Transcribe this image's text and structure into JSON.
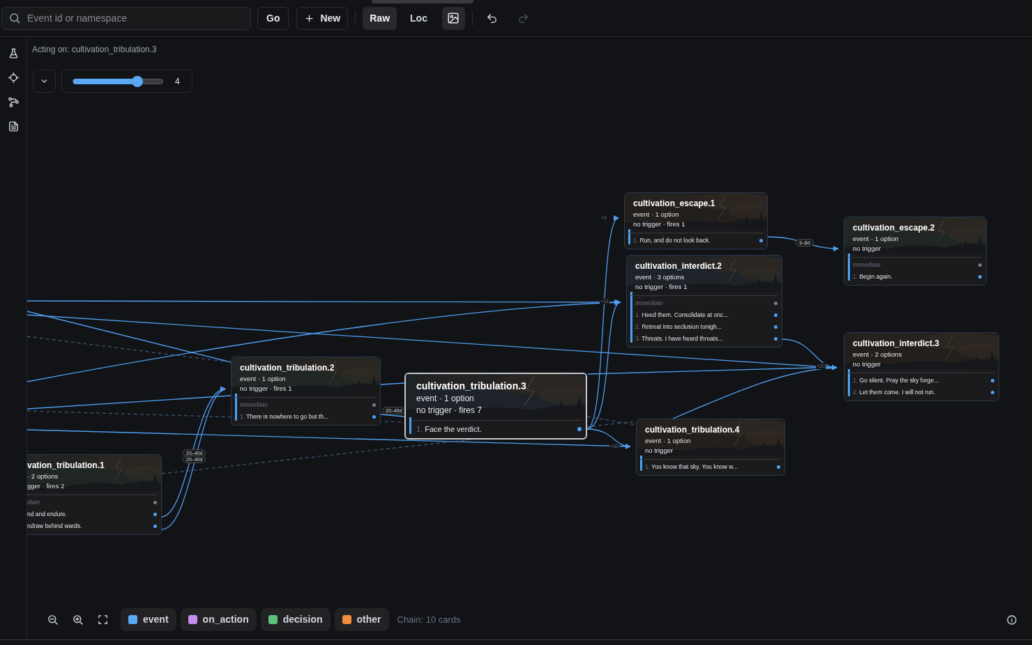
{
  "toolbar": {
    "search": {
      "placeholder": "Event id or namespace"
    },
    "go": "Go",
    "new": "New",
    "modes": [
      {
        "label": "Raw",
        "selected": true
      },
      {
        "label": "Loc",
        "selected": false
      }
    ],
    "image_toggle": {
      "on": true
    },
    "undo": {
      "disabled": false
    },
    "redo": {
      "disabled": true
    }
  },
  "sidebar": {
    "items": [
      {
        "kind": "flask"
      },
      {
        "kind": "target"
      },
      {
        "kind": "graph"
      },
      {
        "kind": "document"
      }
    ]
  },
  "acting_on": "Acting on: cultivation_tribulation.3",
  "depth": {
    "level": 0.72,
    "reading": "4"
  },
  "cards": [
    {
      "title": "cultivation_escape.1",
      "meta": [
        "event · 1 option",
        "no trigger · fires 1"
      ],
      "selected": false,
      "rows": [
        {
          "kind": "option",
          "n": "1.",
          "text": "Run, and do not look back."
        }
      ]
    },
    {
      "title": "cultivation_escape.2",
      "meta": [
        "event · 1 option",
        "no trigger"
      ],
      "selected": false,
      "rows": [
        {
          "kind": "heading",
          "text": "Immediate"
        },
        {
          "kind": "option",
          "n": "1.",
          "text": "Begin again."
        }
      ]
    },
    {
      "title": "cultivation_interdict.2",
      "meta": [
        "event · 3 options",
        "no trigger · fires 1"
      ],
      "selected": false,
      "rows": [
        {
          "kind": "heading",
          "text": "Immediate"
        },
        {
          "kind": "option",
          "n": "1.",
          "text": "Heed them. Consolidate at onc..."
        },
        {
          "kind": "option",
          "n": "2.",
          "text": "Retreat into seclusion tonigh..."
        },
        {
          "kind": "option",
          "n": "3.",
          "text": "Threats. I have heard threats..."
        }
      ]
    },
    {
      "title": "cultivation_interdict.3",
      "meta": [
        "event · 2 options",
        "no trigger"
      ],
      "selected": false,
      "rows": [
        {
          "kind": "option",
          "n": "1.",
          "text": "Go silent. Pray the sky forge..."
        },
        {
          "kind": "option",
          "n": "2.",
          "text": "Let them come. I will not run."
        }
      ]
    },
    {
      "title": "cultivation_tribulation.2",
      "meta": [
        "event · 1 option",
        "no trigger · fires 1"
      ],
      "selected": false,
      "rows": [
        {
          "kind": "heading",
          "text": "Immediate"
        },
        {
          "kind": "option",
          "n": "1.",
          "text": "There is nowhere to go but th..."
        }
      ]
    },
    {
      "title": "cultivation_tribulation.3",
      "meta": [
        "event · 1 option",
        "no trigger · fires 7"
      ],
      "selected": true,
      "rows": [
        {
          "kind": "option",
          "n": "1.",
          "text": "Face the verdict."
        }
      ]
    },
    {
      "title": "cultivation_tribulation.4",
      "meta": [
        "event · 1 option",
        "no trigger"
      ],
      "selected": false,
      "rows": [
        {
          "kind": "option",
          "n": "1.",
          "text": "You know that sky. You know w..."
        }
      ]
    },
    {
      "title": "vation_tribulation.1",
      "meta": [
        "· 2 options",
        "gger · fires 2"
      ],
      "selected": false,
      "rows": [
        {
          "kind": "heading",
          "text": "diate"
        },
        {
          "kind": "option",
          "text": "nd and endure."
        },
        {
          "kind": "option",
          "text": "ndraw behind wards."
        }
      ]
    }
  ],
  "edge_labels": [
    "+2",
    "3–8d",
    "+32",
    "+20",
    "+32",
    "20–40d",
    "20–40d",
    "20–40d"
  ],
  "legend": [
    {
      "label": "event",
      "color": "#5aa9f5"
    },
    {
      "label": "on_action",
      "color": "#c58ef0"
    },
    {
      "label": "decision",
      "color": "#5cc27a"
    },
    {
      "label": "other",
      "color": "#f0913a"
    }
  ],
  "chain": "Chain: 10 cards"
}
